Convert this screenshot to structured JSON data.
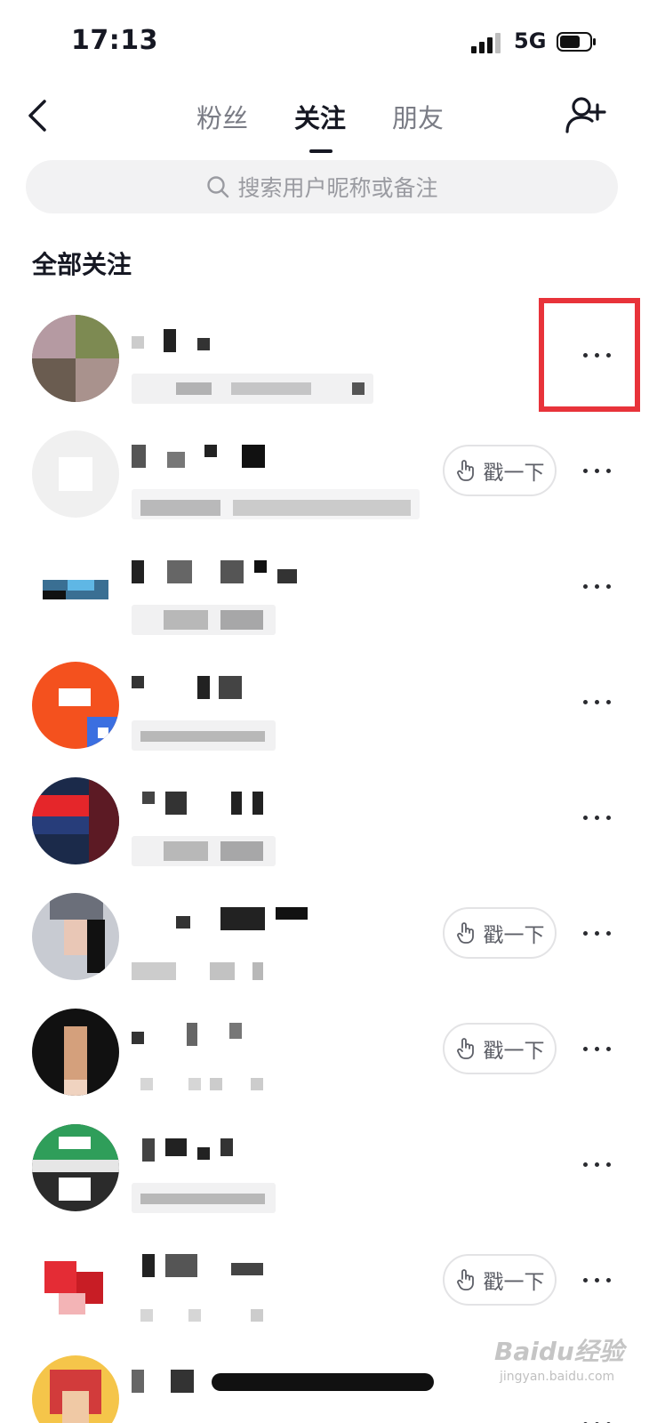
{
  "status_bar": {
    "time": "17:13",
    "network": "5G"
  },
  "nav": {
    "tabs": [
      {
        "label": "粉丝",
        "active": false
      },
      {
        "label": "关注",
        "active": true
      },
      {
        "label": "朋友",
        "active": false
      }
    ]
  },
  "search": {
    "placeholder": "搜索用户昵称或备注"
  },
  "section_title": "全部关注",
  "rows": [
    {
      "poke_label": "",
      "has_poke": false
    },
    {
      "poke_label": "戳一下",
      "has_poke": true
    },
    {
      "poke_label": "",
      "has_poke": false
    },
    {
      "poke_label": "",
      "has_poke": false
    },
    {
      "poke_label": "",
      "has_poke": false
    },
    {
      "poke_label": "戳一下",
      "has_poke": true
    },
    {
      "poke_label": "戳一下",
      "has_poke": true
    },
    {
      "poke_label": "",
      "has_poke": false
    },
    {
      "poke_label": "戳一下",
      "has_poke": true
    },
    {
      "poke_label": "",
      "has_poke": false
    }
  ],
  "watermark": {
    "main": "Baidu经验",
    "sub": "jingyan.baidu.com"
  },
  "colors": {
    "highlight": "#e8333a",
    "text_primary": "#161823",
    "text_secondary": "#7a7c85"
  }
}
